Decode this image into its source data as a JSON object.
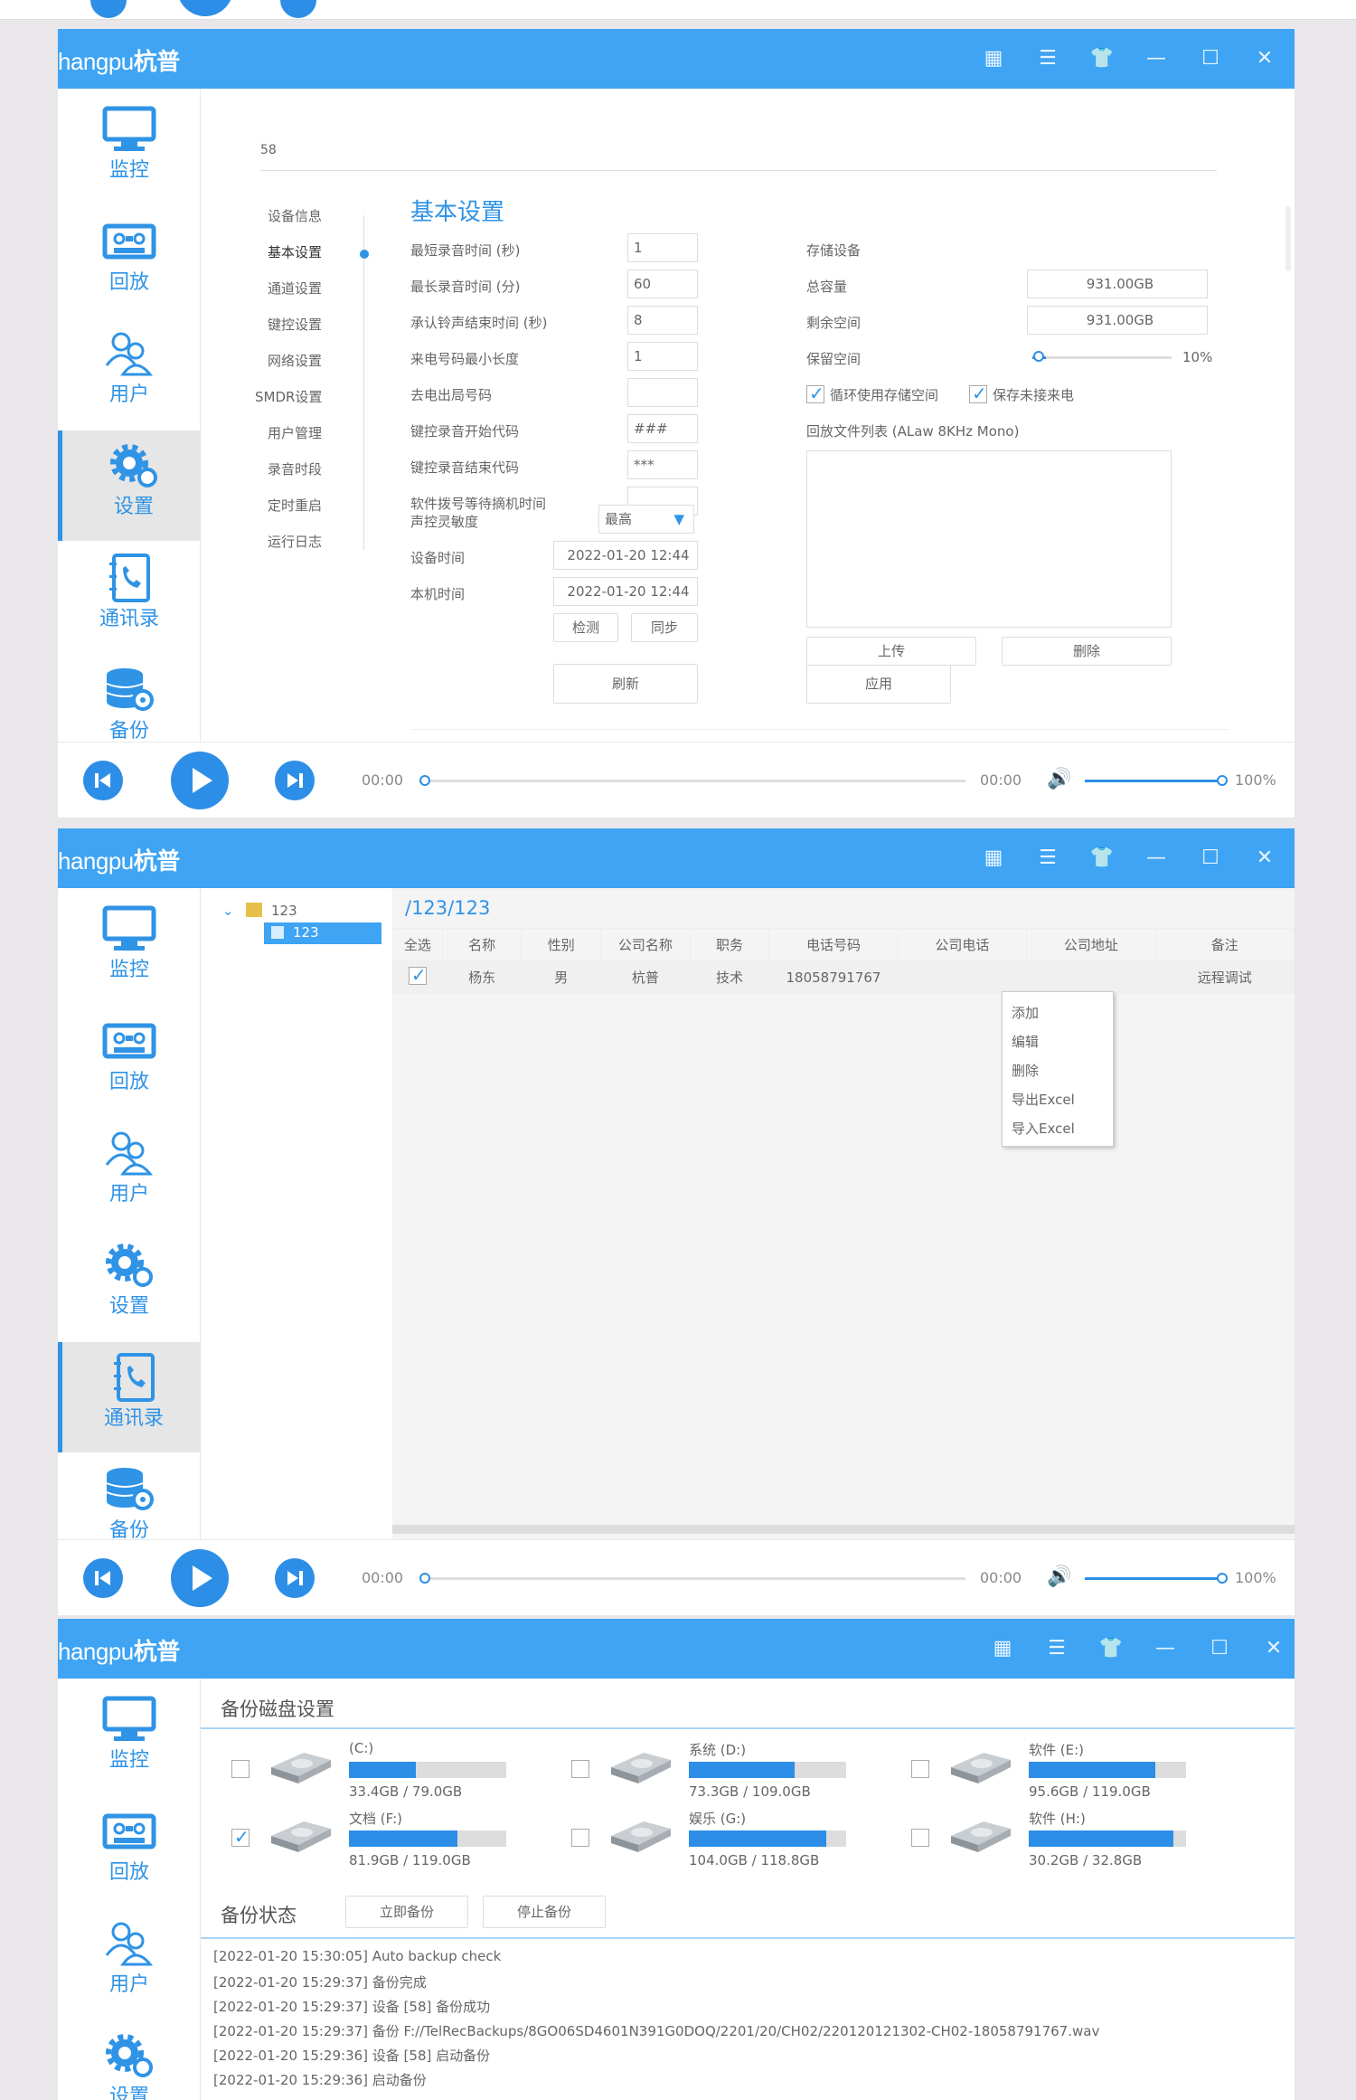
{
  "app": {
    "brand_text": "hangpu",
    "brand_cn": "杭普",
    "title_controls": [
      "grid-icon",
      "list-icon",
      "shirt-icon",
      "minimize-icon",
      "maximize-icon",
      "close-icon"
    ]
  },
  "nav_items": [
    {
      "label": "监控",
      "icon": "monitor-icon"
    },
    {
      "label": "回放",
      "icon": "tape-icon"
    },
    {
      "label": "用户",
      "icon": "users-icon"
    },
    {
      "label": "设置",
      "icon": "gear-icon"
    },
    {
      "label": "通讯录",
      "icon": "phonebook-icon"
    },
    {
      "label": "备份",
      "icon": "database-icon"
    }
  ],
  "player": {
    "time_start": "00:00",
    "time_end": "00:00",
    "volume": "100%",
    "volume_level": 1.0
  },
  "settings_window": {
    "device_tab": "58",
    "active_nav": "设置",
    "menu": [
      "设备信息",
      "基本设置",
      "通道设置",
      "键控设置",
      "网络设置",
      "SMDR设置",
      "用户管理",
      "录音时段",
      "定时重启",
      "运行日志"
    ],
    "active_menu": "基本设置",
    "section_title": "基本设置",
    "fields": [
      {
        "label": "最短录音时间 (秒)",
        "value": "1"
      },
      {
        "label": "最长录音时间 (分)",
        "value": "60"
      },
      {
        "label": "承认铃声结束时间 (秒)",
        "value": "8"
      },
      {
        "label": "来电号码最小长度",
        "value": "1"
      },
      {
        "label": "去电出局号码",
        "value": ""
      },
      {
        "label": "键控录音开始代码",
        "value": "###"
      },
      {
        "label": "键控录音结束代码",
        "value": "***"
      },
      {
        "label": "软件拨号等待摘机时间",
        "value": ""
      }
    ],
    "sensitivity": {
      "label": "声控灵敏度",
      "value": "最高"
    },
    "device_time": {
      "label": "设备时间",
      "value": "2022-01-20 12:44"
    },
    "local_time": {
      "label": "本机时间",
      "value": "2022-01-20 12:44"
    },
    "btn_detect": "检测",
    "btn_sync": "同步",
    "btn_refresh": "刷新",
    "btn_apply": "应用",
    "storage": {
      "title": "存储设备",
      "total_label": "总容量",
      "total_value": "931.00GB",
      "free_label": "剩余空间",
      "free_value": "931.00GB",
      "reserve_label": "保留空间",
      "reserve_value": "10%",
      "reserve_level": 0.1,
      "cb_cycle": "循环使用存储空间",
      "cb_save": "保存未接来电",
      "playlist_label": "回放文件列表 (ALaw 8KHz Mono)",
      "btn_upload": "上传",
      "btn_delete": "删除"
    }
  },
  "contacts_window": {
    "active_nav": "通讯录",
    "tree_root": "123",
    "tree_child": "123",
    "path": "/123/123",
    "columns": [
      "全选",
      "名称",
      "性别",
      "公司名称",
      "职务",
      "电话号码",
      "公司电话",
      "公司地址",
      "备注"
    ],
    "rows": [
      {
        "name": "杨东",
        "gender": "男",
        "company": "杭普",
        "title": "技术",
        "phone": "18058791767",
        "company_phone": "",
        "address": "",
        "note": "远程调试"
      }
    ],
    "context_menu": [
      "添加",
      "编辑",
      "删除",
      "导出Excel",
      "导入Excel"
    ]
  },
  "backup_window": {
    "disk_title": "备份磁盘设置",
    "disks": [
      {
        "name": "(C:)",
        "usage": "33.4GB / 79.0GB",
        "used": 33.4,
        "total": 79.0,
        "checked": false
      },
      {
        "name": "系统 (D:)",
        "usage": "73.3GB / 109.0GB",
        "used": 73.3,
        "total": 109.0,
        "checked": false
      },
      {
        "name": "软件 (E:)",
        "usage": "95.6GB / 119.0GB",
        "used": 95.6,
        "total": 119.0,
        "checked": false
      },
      {
        "name": "文档 (F:)",
        "usage": "81.9GB / 119.0GB",
        "used": 81.9,
        "total": 119.0,
        "checked": true
      },
      {
        "name": "娱乐 (G:)",
        "usage": "104.0GB / 118.8GB",
        "used": 104.0,
        "total": 118.8,
        "checked": false
      },
      {
        "name": "软件 (H:)",
        "usage": "30.2GB / 32.8GB",
        "used": 30.2,
        "total": 32.8,
        "checked": false
      }
    ],
    "status_title": "备份状态",
    "btn_backup_now": "立即备份",
    "btn_stop": "停止备份",
    "logs": [
      "[2022-01-20 15:30:05] Auto backup check",
      "[2022-01-20 15:29:37] 备份完成",
      "[2022-01-20 15:29:37] 设备 [58] 备份成功",
      "[2022-01-20 15:29:37] 备份 F://TelRecBackups/8GO06SD4601N391G0DOQ/2201/20/CH02/220120121302-CH02-18058791767.wav",
      "[2022-01-20 15:29:36] 设备 [58] 启动备份",
      "[2022-01-20 15:29:36] 启动备份"
    ]
  },
  "colors": {
    "accent": "#3ea4f3",
    "nav_text": "#2f93e6",
    "player_btn": "#2c8ee6"
  }
}
